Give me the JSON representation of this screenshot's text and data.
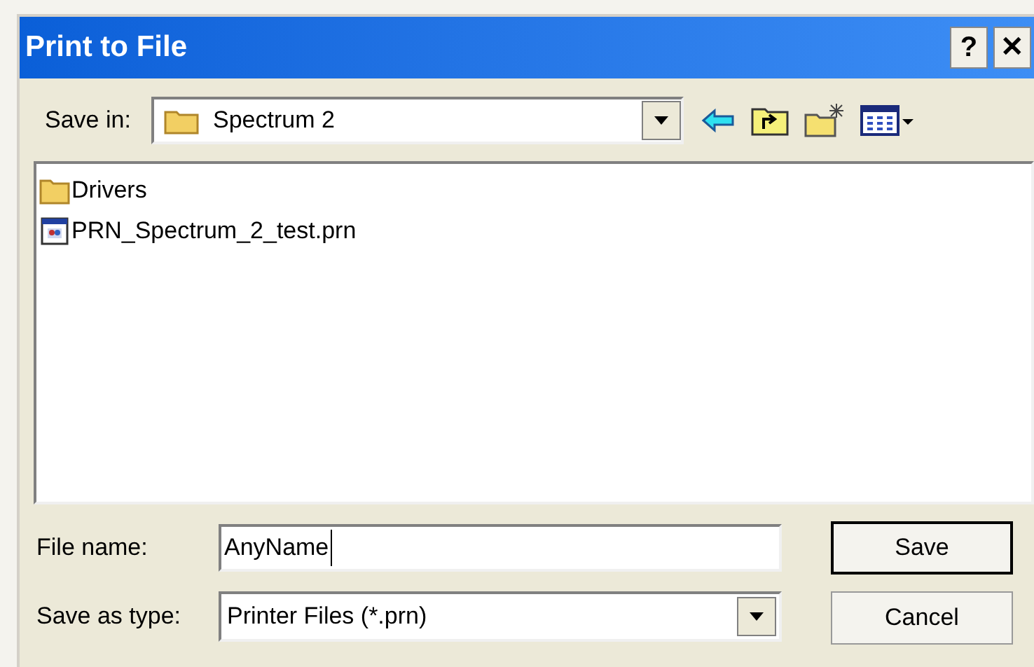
{
  "window": {
    "title": "Print to File",
    "title_buttons": [
      "?",
      "✕"
    ]
  },
  "save_in": {
    "label": "Save in:",
    "value": "Spectrum 2"
  },
  "files": [
    {
      "name": "Drivers",
      "kind": "folder"
    },
    {
      "name": "PRN_Spectrum_2_test.prn",
      "kind": "file"
    }
  ],
  "file_name": {
    "label": "File name:",
    "value": "AnyName"
  },
  "save_as_type": {
    "label": "Save as type:",
    "value": "Printer Files (*.prn)"
  },
  "buttons": [
    {
      "label": "Save",
      "default": true
    },
    {
      "label": "Cancel",
      "default": false
    }
  ]
}
